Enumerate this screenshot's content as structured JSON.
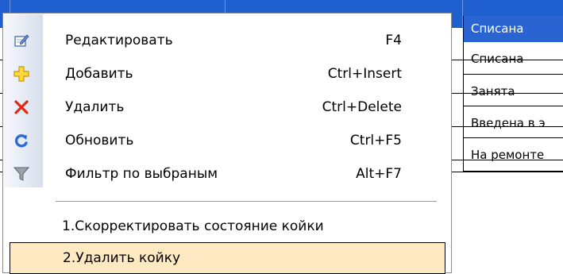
{
  "grid": {
    "status_cells": [
      "Списана",
      "Списана",
      "Занята",
      "Введена в э",
      "На ремонте"
    ]
  },
  "menu": {
    "items": [
      {
        "label": "Редактировать",
        "shortcut": "F4",
        "icon": "edit-icon"
      },
      {
        "label": "Добавить",
        "shortcut": "Ctrl+Insert",
        "icon": "plus-icon"
      },
      {
        "label": "Удалить",
        "shortcut": "Ctrl+Delete",
        "icon": "delete-x-icon"
      },
      {
        "label": "Обновить",
        "shortcut": "Ctrl+F5",
        "icon": "refresh-icon"
      },
      {
        "label": "Фильтр по выбраным",
        "shortcut": "Alt+F7",
        "icon": "filter-icon"
      }
    ],
    "extra_items": [
      {
        "label": "1.Скорректировать состояние койки"
      },
      {
        "label": "2.Удалить койку",
        "highlighted": true
      }
    ]
  },
  "colors": {
    "header_blue": "#1f5fd0",
    "selection_blue": "#2a64d2",
    "hover_bg": "#fde9c2",
    "separator": "#7ea0d6"
  }
}
